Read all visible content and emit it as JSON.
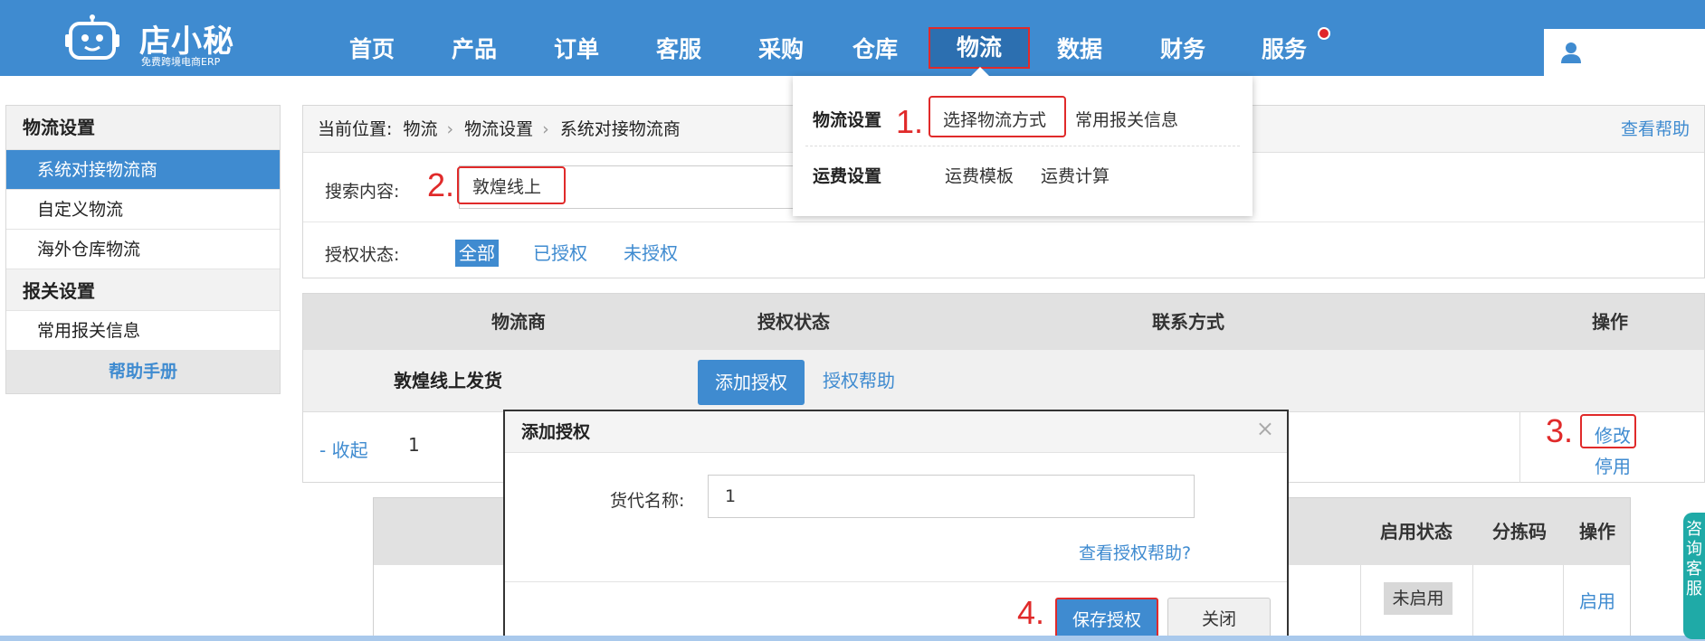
{
  "brand": {
    "name": "店小秘",
    "slogan": "免费跨境电商ERP"
  },
  "nav": {
    "items": [
      {
        "label": "首页"
      },
      {
        "label": "产品"
      },
      {
        "label": "订单"
      },
      {
        "label": "客服"
      },
      {
        "label": "采购"
      },
      {
        "label": "仓库"
      },
      {
        "label": "物流",
        "active": true
      },
      {
        "label": "数据"
      },
      {
        "label": "财务"
      },
      {
        "label": "服务",
        "notification": true
      }
    ]
  },
  "dropdown": {
    "group1_title": "物流设置",
    "group1_items": [
      "选择物流方式",
      "常用报关信息"
    ],
    "group2_title": "运费设置",
    "group2_items": [
      "运费模板",
      "运费计算"
    ]
  },
  "sidebar": {
    "section1": "物流设置",
    "section1_items": [
      "系统对接物流商",
      "自定义物流",
      "海外仓库物流"
    ],
    "section2": "报关设置",
    "section2_items": [
      "常用报关信息"
    ],
    "help": "帮助手册"
  },
  "breadcrumb": {
    "prefix": "当前位置:",
    "items": [
      "物流",
      "物流设置",
      "系统对接物流商"
    ],
    "help_link": "查看帮助"
  },
  "filters": {
    "search_label": "搜索内容:",
    "search_value": "敦煌线上",
    "status_label": "授权状态:",
    "status_options": [
      "全部",
      "已授权",
      "未授权"
    ]
  },
  "annotations": [
    "1.",
    "2.",
    "3.",
    "4."
  ],
  "table": {
    "headers": [
      "物流商",
      "授权状态",
      "联系方式",
      "操作"
    ],
    "provider_name": "敦煌线上发货",
    "add_auth": "添加授权",
    "auth_help": "授权帮助",
    "collapse": "- 收起",
    "index": "1",
    "edit": "修改",
    "disable": "停用"
  },
  "sub_table": {
    "headers": [
      "启用状态",
      "分拣码",
      "操作"
    ],
    "status": "未启用",
    "action": "启用"
  },
  "modal": {
    "title": "添加授权",
    "close": "×",
    "forwarder_label": "货代名称:",
    "forwarder_value": "1",
    "help_link": "查看授权帮助?",
    "save": "保存授权",
    "cancel": "关闭"
  },
  "consult_tab": "咨询客服",
  "colors": {
    "primary": "#3f8bd0",
    "highlight": "#e02a2a",
    "consult": "#1faaa7"
  }
}
